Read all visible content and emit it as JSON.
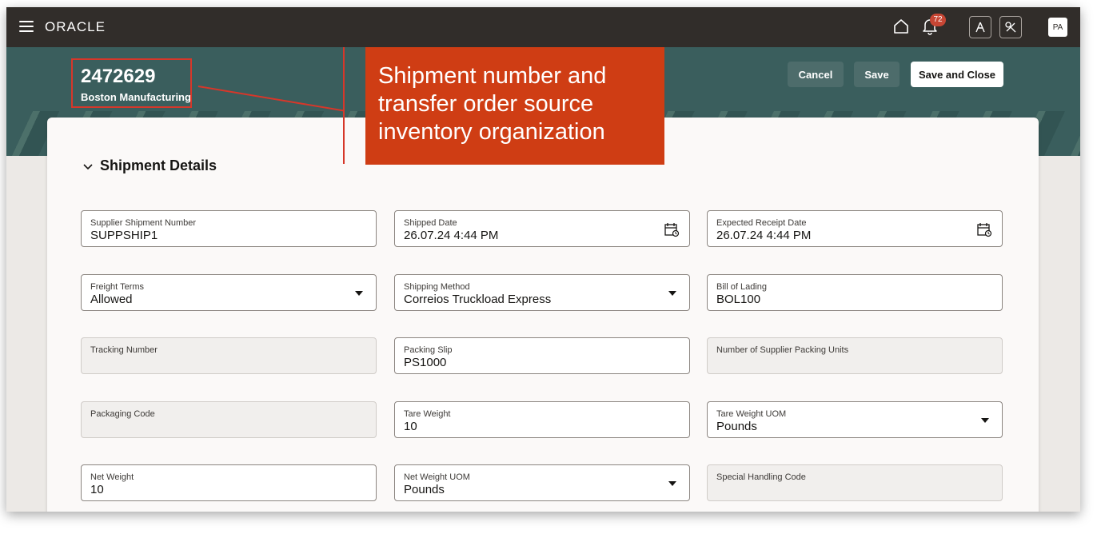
{
  "topbar": {
    "brand": "ORACLE",
    "notification_count": "72",
    "avatar_initials": "PA"
  },
  "header": {
    "shipment_number": "2472629",
    "organization": "Boston Manufacturing",
    "cancel_label": "Cancel",
    "save_label": "Save",
    "save_close_label": "Save and Close"
  },
  "callout": {
    "text": "Shipment number and transfer order source inventory organization"
  },
  "section": {
    "title": "Shipment Details"
  },
  "fields": {
    "supplier_shipment_number": {
      "label": "Supplier Shipment Number",
      "value": "SUPPSHIP1"
    },
    "shipped_date": {
      "label": "Shipped Date",
      "value": "26.07.24 4:44 PM"
    },
    "expected_receipt_date": {
      "label": "Expected Receipt Date",
      "value": "26.07.24 4:44 PM"
    },
    "freight_terms": {
      "label": "Freight Terms",
      "value": "Allowed"
    },
    "shipping_method": {
      "label": "Shipping Method",
      "value": "Correios Truckload Express"
    },
    "bill_of_lading": {
      "label": "Bill of Lading",
      "value": "BOL100"
    },
    "tracking_number": {
      "label": "Tracking Number",
      "value": ""
    },
    "packing_slip": {
      "label": "Packing Slip",
      "value": "PS1000"
    },
    "supplier_packing_units": {
      "label": "Number of Supplier Packing Units",
      "value": ""
    },
    "packaging_code": {
      "label": "Packaging Code",
      "value": ""
    },
    "tare_weight": {
      "label": "Tare Weight",
      "value": "10"
    },
    "tare_weight_uom": {
      "label": "Tare Weight UOM",
      "value": "Pounds"
    },
    "net_weight": {
      "label": "Net Weight",
      "value": "10"
    },
    "net_weight_uom": {
      "label": "Net Weight UOM",
      "value": "Pounds"
    },
    "special_handling_code": {
      "label": "Special Handling Code",
      "value": ""
    }
  },
  "colors": {
    "topbar": "#312d2a",
    "banner": "#3a5e5d",
    "callout": "#cf3d14",
    "highlight_border": "#d6372a",
    "badge": "#c74634"
  }
}
